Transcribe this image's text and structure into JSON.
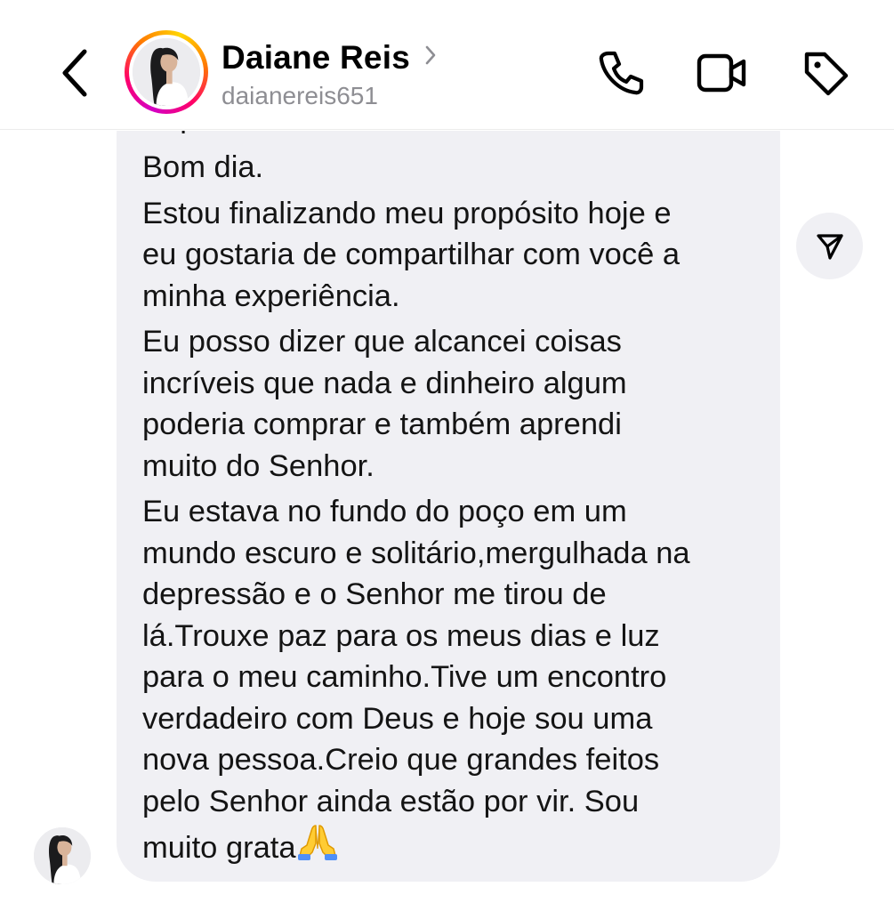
{
  "header": {
    "back_icon": "chevron-left-icon",
    "contact_name": "Daiane Reis",
    "contact_username": "daianereis651",
    "name_chevron_icon": "chevron-right-icon",
    "actions": {
      "call_icon": "phone-icon",
      "video_icon": "video-camera-icon",
      "tag_icon": "tag-icon"
    },
    "story_ring_colors": [
      "#d300c5",
      "#ff0069",
      "#ff7a00",
      "#ffd600"
    ]
  },
  "message": {
    "clipped_top_line": "Sup…",
    "paragraphs": [
      "Bom dia.",
      "Estou finalizando meu propósito hoje e\neu gostaria de compartilhar com você a\nminha experiência.",
      "Eu posso dizer que alcancei coisas\nincríveis que nada e dinheiro algum\npoderia comprar e também aprendi\nmuito do Senhor.",
      "Eu estava no fundo do poço em um\nmundo escuro e solitário,mergulhada na\ndepressão e o Senhor me tirou de\nlá.Trouxe paz para os meus dias e luz\npara o meu caminho.Tive um encontro\nverdadeiro com Deus e hoje sou uma\nnova pessoa.Creio que grandes feitos\npelo Senhor ainda estão por vir. Sou\nmuito grata"
    ],
    "emoji": "folded-hands-emoji",
    "share_icon": "send-paper-plane-icon",
    "bubble_color": "#f0f0f4"
  }
}
